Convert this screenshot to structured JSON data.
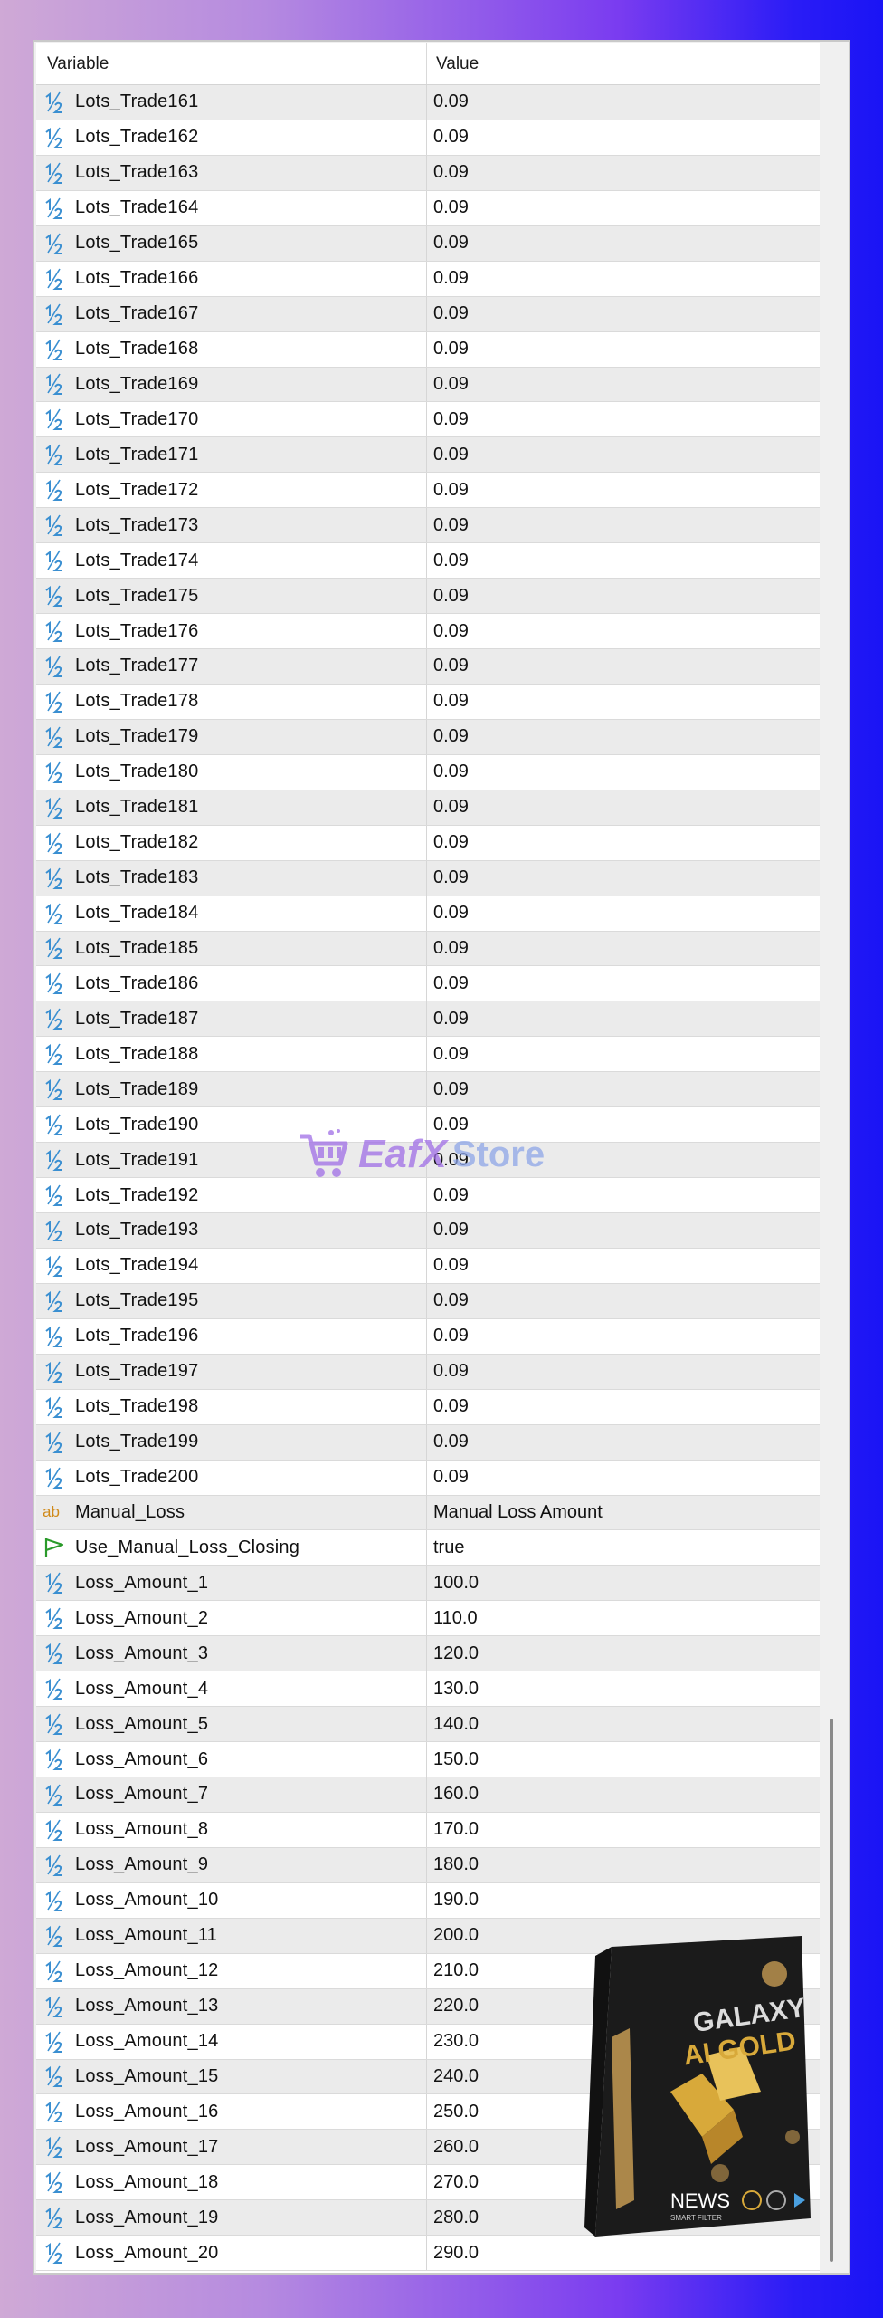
{
  "table": {
    "headers": {
      "variable": "Variable",
      "value": "Value"
    },
    "rows": [
      {
        "type": "double",
        "name": "Lots_Trade161",
        "value": "0.09"
      },
      {
        "type": "double",
        "name": "Lots_Trade162",
        "value": "0.09"
      },
      {
        "type": "double",
        "name": "Lots_Trade163",
        "value": "0.09"
      },
      {
        "type": "double",
        "name": "Lots_Trade164",
        "value": "0.09"
      },
      {
        "type": "double",
        "name": "Lots_Trade165",
        "value": "0.09"
      },
      {
        "type": "double",
        "name": "Lots_Trade166",
        "value": "0.09"
      },
      {
        "type": "double",
        "name": "Lots_Trade167",
        "value": "0.09"
      },
      {
        "type": "double",
        "name": "Lots_Trade168",
        "value": "0.09"
      },
      {
        "type": "double",
        "name": "Lots_Trade169",
        "value": "0.09"
      },
      {
        "type": "double",
        "name": "Lots_Trade170",
        "value": "0.09"
      },
      {
        "type": "double",
        "name": "Lots_Trade171",
        "value": "0.09"
      },
      {
        "type": "double",
        "name": "Lots_Trade172",
        "value": "0.09"
      },
      {
        "type": "double",
        "name": "Lots_Trade173",
        "value": "0.09"
      },
      {
        "type": "double",
        "name": "Lots_Trade174",
        "value": "0.09"
      },
      {
        "type": "double",
        "name": "Lots_Trade175",
        "value": "0.09"
      },
      {
        "type": "double",
        "name": "Lots_Trade176",
        "value": "0.09"
      },
      {
        "type": "double",
        "name": "Lots_Trade177",
        "value": "0.09"
      },
      {
        "type": "double",
        "name": "Lots_Trade178",
        "value": "0.09"
      },
      {
        "type": "double",
        "name": "Lots_Trade179",
        "value": "0.09"
      },
      {
        "type": "double",
        "name": "Lots_Trade180",
        "value": "0.09"
      },
      {
        "type": "double",
        "name": "Lots_Trade181",
        "value": "0.09"
      },
      {
        "type": "double",
        "name": "Lots_Trade182",
        "value": "0.09"
      },
      {
        "type": "double",
        "name": "Lots_Trade183",
        "value": "0.09"
      },
      {
        "type": "double",
        "name": "Lots_Trade184",
        "value": "0.09"
      },
      {
        "type": "double",
        "name": "Lots_Trade185",
        "value": "0.09"
      },
      {
        "type": "double",
        "name": "Lots_Trade186",
        "value": "0.09"
      },
      {
        "type": "double",
        "name": "Lots_Trade187",
        "value": "0.09"
      },
      {
        "type": "double",
        "name": "Lots_Trade188",
        "value": "0.09"
      },
      {
        "type": "double",
        "name": "Lots_Trade189",
        "value": "0.09"
      },
      {
        "type": "double",
        "name": "Lots_Trade190",
        "value": "0.09"
      },
      {
        "type": "double",
        "name": "Lots_Trade191",
        "value": "0.09"
      },
      {
        "type": "double",
        "name": "Lots_Trade192",
        "value": "0.09"
      },
      {
        "type": "double",
        "name": "Lots_Trade193",
        "value": "0.09"
      },
      {
        "type": "double",
        "name": "Lots_Trade194",
        "value": "0.09"
      },
      {
        "type": "double",
        "name": "Lots_Trade195",
        "value": "0.09"
      },
      {
        "type": "double",
        "name": "Lots_Trade196",
        "value": "0.09"
      },
      {
        "type": "double",
        "name": "Lots_Trade197",
        "value": "0.09"
      },
      {
        "type": "double",
        "name": "Lots_Trade198",
        "value": "0.09"
      },
      {
        "type": "double",
        "name": "Lots_Trade199",
        "value": "0.09"
      },
      {
        "type": "double",
        "name": "Lots_Trade200",
        "value": "0.09"
      },
      {
        "type": "string",
        "name": "Manual_Loss",
        "value": "Manual Loss Amount"
      },
      {
        "type": "bool",
        "name": "Use_Manual_Loss_Closing",
        "value": "true"
      },
      {
        "type": "double",
        "name": "Loss_Amount_1",
        "value": "100.0"
      },
      {
        "type": "double",
        "name": "Loss_Amount_2",
        "value": "110.0"
      },
      {
        "type": "double",
        "name": "Loss_Amount_3",
        "value": "120.0"
      },
      {
        "type": "double",
        "name": "Loss_Amount_4",
        "value": "130.0"
      },
      {
        "type": "double",
        "name": "Loss_Amount_5",
        "value": "140.0"
      },
      {
        "type": "double",
        "name": "Loss_Amount_6",
        "value": "150.0"
      },
      {
        "type": "double",
        "name": "Loss_Amount_7",
        "value": "160.0"
      },
      {
        "type": "double",
        "name": "Loss_Amount_8",
        "value": "170.0"
      },
      {
        "type": "double",
        "name": "Loss_Amount_9",
        "value": "180.0"
      },
      {
        "type": "double",
        "name": "Loss_Amount_10",
        "value": "190.0"
      },
      {
        "type": "double",
        "name": "Loss_Amount_11",
        "value": "200.0"
      },
      {
        "type": "double",
        "name": "Loss_Amount_12",
        "value": "210.0"
      },
      {
        "type": "double",
        "name": "Loss_Amount_13",
        "value": "220.0"
      },
      {
        "type": "double",
        "name": "Loss_Amount_14",
        "value": "230.0"
      },
      {
        "type": "double",
        "name": "Loss_Amount_15",
        "value": "240.0"
      },
      {
        "type": "double",
        "name": "Loss_Amount_16",
        "value": "250.0"
      },
      {
        "type": "double",
        "name": "Loss_Amount_17",
        "value": "260.0"
      },
      {
        "type": "double",
        "name": "Loss_Amount_18",
        "value": "270.0"
      },
      {
        "type": "double",
        "name": "Loss_Amount_19",
        "value": "280.0"
      },
      {
        "type": "double",
        "name": "Loss_Amount_20",
        "value": "290.0"
      }
    ]
  },
  "icons": {
    "double": "half-fraction-icon",
    "string": "ab-text-icon",
    "bool": "green-flag-arrow-icon"
  },
  "watermark": {
    "brand": "EafX",
    "suffix": "Store"
  },
  "product_box": {
    "title_line1": "GALAXY",
    "title_line2": "AI GOLD",
    "badge": "NEWS",
    "badge_sub": "SMART FILTER",
    "colors": {
      "gold": "#d8a93a",
      "dark": "#1b1b1b"
    }
  },
  "colors": {
    "row_alt": "#ebebeb",
    "row": "#ffffff",
    "text": "#111111",
    "accent_bg": "#7a3cf0"
  }
}
